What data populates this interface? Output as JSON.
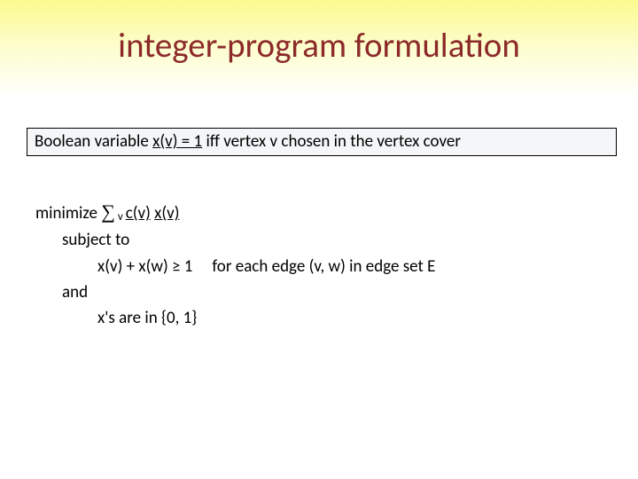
{
  "title": "integer-program formulation",
  "definition": {
    "pre": "Boolean variable ",
    "var": "x(v) = 1",
    "post": " iff vertex v chosen in the vertex cover"
  },
  "lp": {
    "min_word": "minimize ",
    "sigma": "∑",
    "sub": " v ",
    "obj1": "c(v)",
    "obj2": "x(v)",
    "subject": "subject to",
    "constr_lhs": "x(v) + x(w)  ≥ 1",
    "constr_rhs": "for each edge (v, w) in edge set E",
    "and": "and",
    "domain": "x's are in {0, 1}"
  }
}
